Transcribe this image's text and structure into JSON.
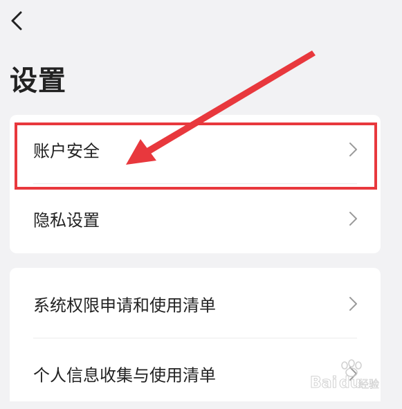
{
  "header": {
    "back_icon": "chevron-left-icon",
    "title": "设置"
  },
  "groups": [
    {
      "items": [
        {
          "label": "账户安全",
          "icon": "chevron-right-icon"
        },
        {
          "label": "隐私设置",
          "icon": "chevron-right-icon"
        }
      ]
    },
    {
      "items": [
        {
          "label": "系统权限申请和使用清单",
          "icon": "chevron-right-icon"
        },
        {
          "label": "个人信息收集与使用清单",
          "icon": "chevron-right-icon"
        }
      ]
    }
  ],
  "annotation": {
    "color": "#e8383d",
    "highlighted_item": "账户安全"
  },
  "watermark": {
    "text": "Baidu经验"
  },
  "colors": {
    "background": "#f2f2f4",
    "card": "#ffffff",
    "text": "#222222",
    "chevron": "#9a9a9a"
  }
}
